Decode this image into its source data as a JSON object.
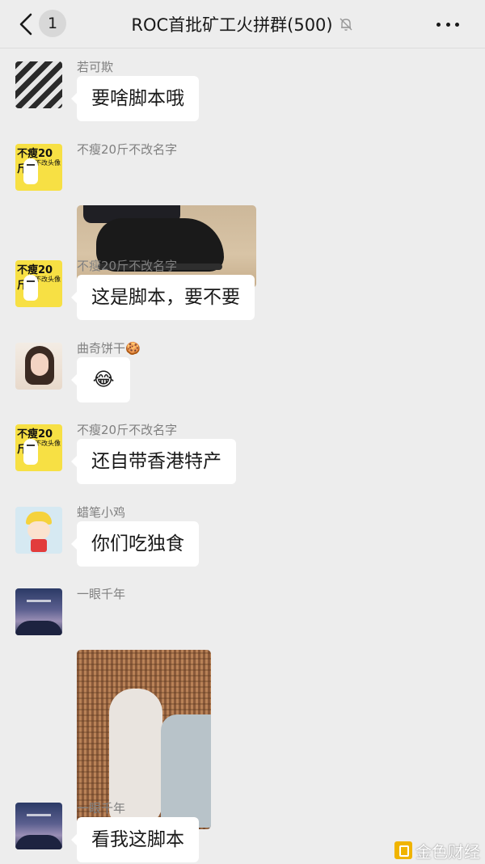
{
  "header": {
    "back_count": "1",
    "title": "ROC首批矿工火拼群(500)"
  },
  "messages": [
    {
      "sender": "若可欺",
      "text": "要啥脚本哦"
    },
    {
      "sender": "不瘦20斤不改名字",
      "image": "black-shoe-photo"
    },
    {
      "sender": "不瘦20斤不改名字",
      "text": "这是脚本，要不要"
    },
    {
      "sender": "曲奇饼干🍪",
      "text": "😂"
    },
    {
      "sender": "不瘦20斤不改名字",
      "text": "还自带香港特产"
    },
    {
      "sender": "蜡笔小鸡",
      "text": "你们吃独食"
    },
    {
      "sender": "一眼千年",
      "image": "bare-foot-photo"
    },
    {
      "sender": "一眼千年",
      "text": "看我这脚本"
    }
  ],
  "avatars": {
    "yellow_sticker_title": "不瘦20斤",
    "yellow_sticker_sub": "不改头像"
  },
  "watermark": {
    "text": "金色财经"
  },
  "colors": {
    "background": "#ededed",
    "bubble": "#ffffff",
    "sender": "#808080",
    "title": "#191919"
  }
}
